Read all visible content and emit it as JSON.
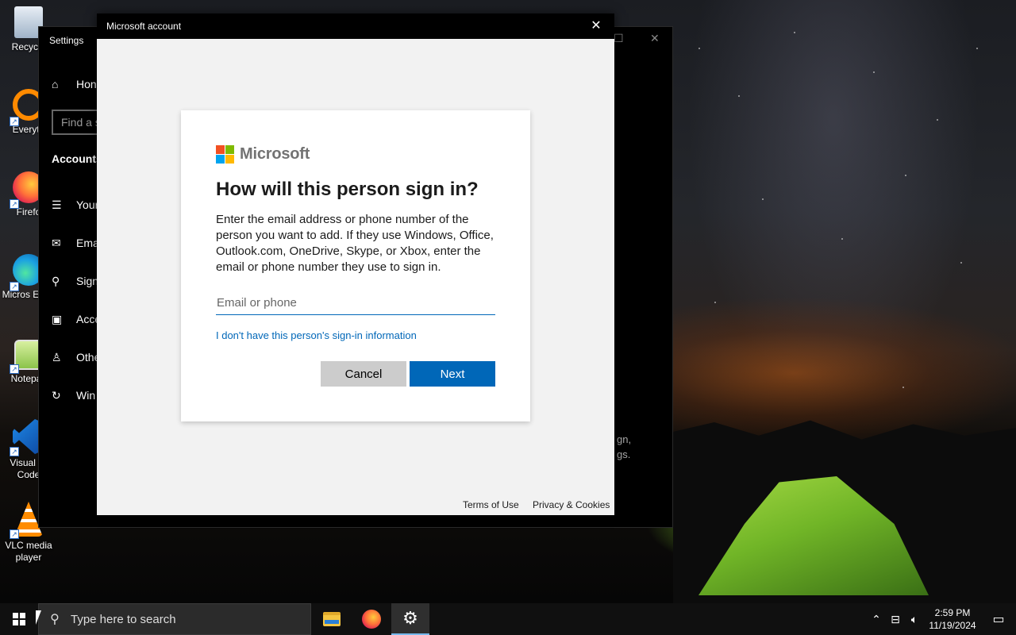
{
  "desktop": {
    "icons": [
      {
        "label": "Recycle",
        "icon": "recycle-bin-icon"
      },
      {
        "label": "Everyth",
        "icon": "everything-icon"
      },
      {
        "label": "Firefo",
        "icon": "firefox-icon"
      },
      {
        "label": "Micros Edge",
        "icon": "edge-icon"
      },
      {
        "label": "Notepac",
        "icon": "notepad-icon"
      },
      {
        "label": "Visual St Code",
        "icon": "vscode-icon"
      },
      {
        "label": "VLC media player",
        "icon": "vlc-icon"
      }
    ]
  },
  "settings": {
    "title": "Settings",
    "search_placeholder": "Find a s",
    "nav_home": "Hon",
    "section_heading": "Accounts",
    "nav": [
      {
        "label": "Your",
        "icon": "person-card-icon"
      },
      {
        "label": "Ema",
        "icon": "mail-icon"
      },
      {
        "label": "Sign",
        "icon": "key-icon"
      },
      {
        "label": "Acce",
        "icon": "briefcase-icon"
      },
      {
        "label": "Othe",
        "icon": "add-person-icon"
      },
      {
        "label": "Win",
        "icon": "sync-icon"
      }
    ],
    "right_text_1": "gn,",
    "right_text_2": "gs."
  },
  "dialog": {
    "window_title": "Microsoft account",
    "close_glyph": "✕",
    "logo_text": "Microsoft",
    "heading": "How will this person sign in?",
    "description": "Enter the email address or phone number of the person you want to add. If they use Windows, Office, Outlook.com, OneDrive, Skype, or Xbox, enter the email or phone number they use to sign in.",
    "email_placeholder": "Email or phone",
    "email_value": "",
    "no_info_link": "I don't have this person's sign-in information",
    "cancel_label": "Cancel",
    "next_label": "Next",
    "footer_terms": "Terms of Use",
    "footer_privacy": "Privacy & Cookies",
    "colors": {
      "accent": "#0067b8",
      "cancel_bg": "#cccccc"
    }
  },
  "taskbar": {
    "search_placeholder": "Type here to search",
    "time": "2:59 PM",
    "date": "11/19/2024",
    "apps": [
      {
        "name": "File Explorer",
        "icon": "folder-icon"
      },
      {
        "name": "Firefox",
        "icon": "firefox-icon"
      },
      {
        "name": "Settings",
        "icon": "gear-icon",
        "active": true
      }
    ]
  }
}
